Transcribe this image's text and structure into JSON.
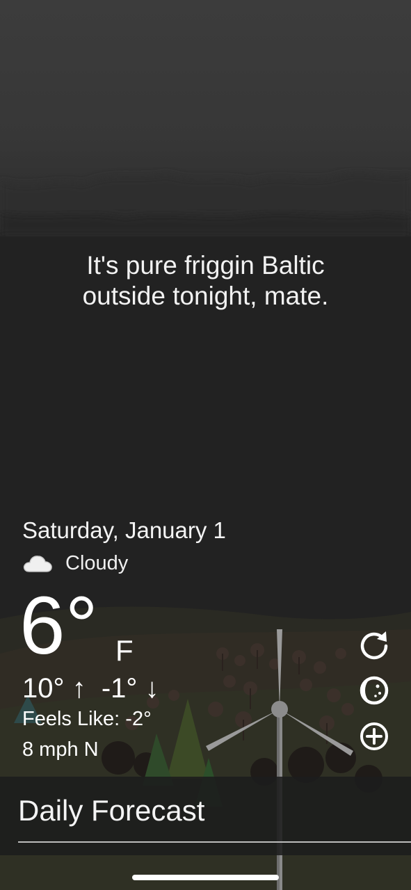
{
  "message": {
    "line1": "It's pure friggin Baltic",
    "line2": "outside tonight, mate."
  },
  "weather": {
    "date": "Saturday, January 1",
    "condition_icon": "cloud-icon",
    "condition": "Cloudy",
    "temperature": "6°",
    "unit": "F",
    "high_low": "10° ↑  -1° ↓",
    "feels_like": "Feels Like: -2°",
    "wind": "8 mph N"
  },
  "actions": [
    {
      "name": "refresh-icon"
    },
    {
      "name": "moon-phase-icon"
    },
    {
      "name": "add-icon"
    }
  ],
  "forecast": {
    "title": "Daily Forecast"
  },
  "colors": {
    "sky": "#3a3a3a",
    "background": "#222222",
    "text": "#ffffff"
  }
}
